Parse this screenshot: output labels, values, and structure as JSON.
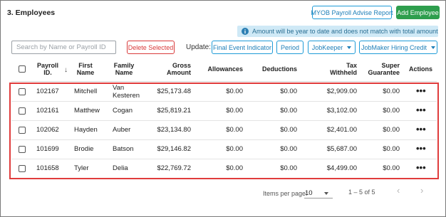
{
  "section": {
    "title": "3. Employees"
  },
  "toolbar": {
    "myob_report_label": "MYOB Payroll Advise Report",
    "add_employee_label": "Add Employee"
  },
  "info": {
    "icon": "info-icon",
    "message": "Amount will be year to date and does not match with total amount"
  },
  "filters": {
    "search_placeholder": "Search by Name or Payroll ID",
    "delete_selected_label": "Delete Selected",
    "update_label": "Update:",
    "final_event_label": "Final Event Indicator",
    "period_label": "Period",
    "jobkeeper_label": "JobKeeper",
    "jobmaker_label": "JobMaker Hiring Credit"
  },
  "table": {
    "headers": {
      "payroll_id": "Payroll ID.",
      "first_name": "First Name",
      "family_name": "Family Name",
      "gross_amount": "Gross Amount",
      "allowances": "Allowances",
      "deductions": "Deductions",
      "tax_withheld": "Tax Withheld",
      "super_guarantee": "Super Guarantee",
      "actions": "Actions"
    },
    "rows": [
      {
        "id": "102167",
        "first": "Mitchell",
        "family": "Van Kesteren",
        "gross": "$25,173.48",
        "allow": "$0.00",
        "deduct": "$0.00",
        "tax": "$2,909.00",
        "super": "$0.00",
        "actions": "•••"
      },
      {
        "id": "102161",
        "first": "Matthew",
        "family": "Cogan",
        "gross": "$25,819.21",
        "allow": "$0.00",
        "deduct": "$0.00",
        "tax": "$3,102.00",
        "super": "$0.00",
        "actions": "•••"
      },
      {
        "id": "102062",
        "first": "Hayden",
        "family": "Auber",
        "gross": "$23,134.80",
        "allow": "$0.00",
        "deduct": "$0.00",
        "tax": "$2,401.00",
        "super": "$0.00",
        "actions": "•••"
      },
      {
        "id": "101699",
        "first": "Brodie",
        "family": "Batson",
        "gross": "$29,146.82",
        "allow": "$0.00",
        "deduct": "$0.00",
        "tax": "$5,687.00",
        "super": "$0.00",
        "actions": "•••"
      },
      {
        "id": "101658",
        "first": "Tyler",
        "family": "Delia",
        "gross": "$22,769.72",
        "allow": "$0.00",
        "deduct": "$0.00",
        "tax": "$4,499.00",
        "super": "$0.00",
        "actions": "•••"
      }
    ]
  },
  "pagination": {
    "items_per_page_label": "Items per page:",
    "items_per_page_value": "10",
    "range_label": "1 – 5 of 5"
  },
  "colors": {
    "accent_blue": "#1e9bd7",
    "add_green": "#2e9e4d",
    "delete_red": "#d93a3a",
    "highlight_red": "#e03c3c",
    "info_bg": "#cfe9f6"
  }
}
